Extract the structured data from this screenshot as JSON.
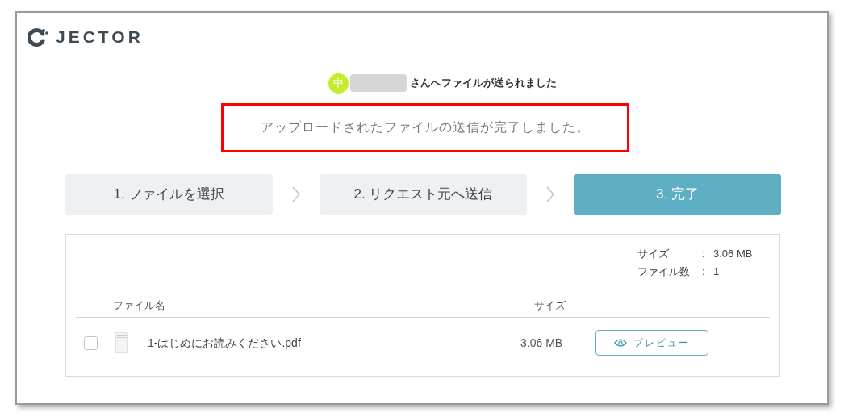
{
  "header": {
    "logo": "JECTOR"
  },
  "recipient": {
    "avatar": "中",
    "message": "さんへファイルが送られました"
  },
  "notice": "アップロードされたファイルの送信が完了しました。",
  "steps": [
    {
      "label": "1. ファイルを選択",
      "selected": false
    },
    {
      "label": "2. リクエスト元へ送信",
      "selected": false
    },
    {
      "label": "3. 完了",
      "selected": true
    }
  ],
  "summary": [
    {
      "label": "サイズ",
      "separator": ":",
      "value": "3.06 MB"
    },
    {
      "label": "ファイル数",
      "separator": ":",
      "value": "1"
    }
  ],
  "table": {
    "columns": [
      "ファイル名",
      "サイズ"
    ],
    "rows": [
      {
        "checked": false,
        "name": "1-はじめにお読みください.pdf",
        "size": "3.06 MB",
        "action": "プレビュー"
      }
    ]
  }
}
